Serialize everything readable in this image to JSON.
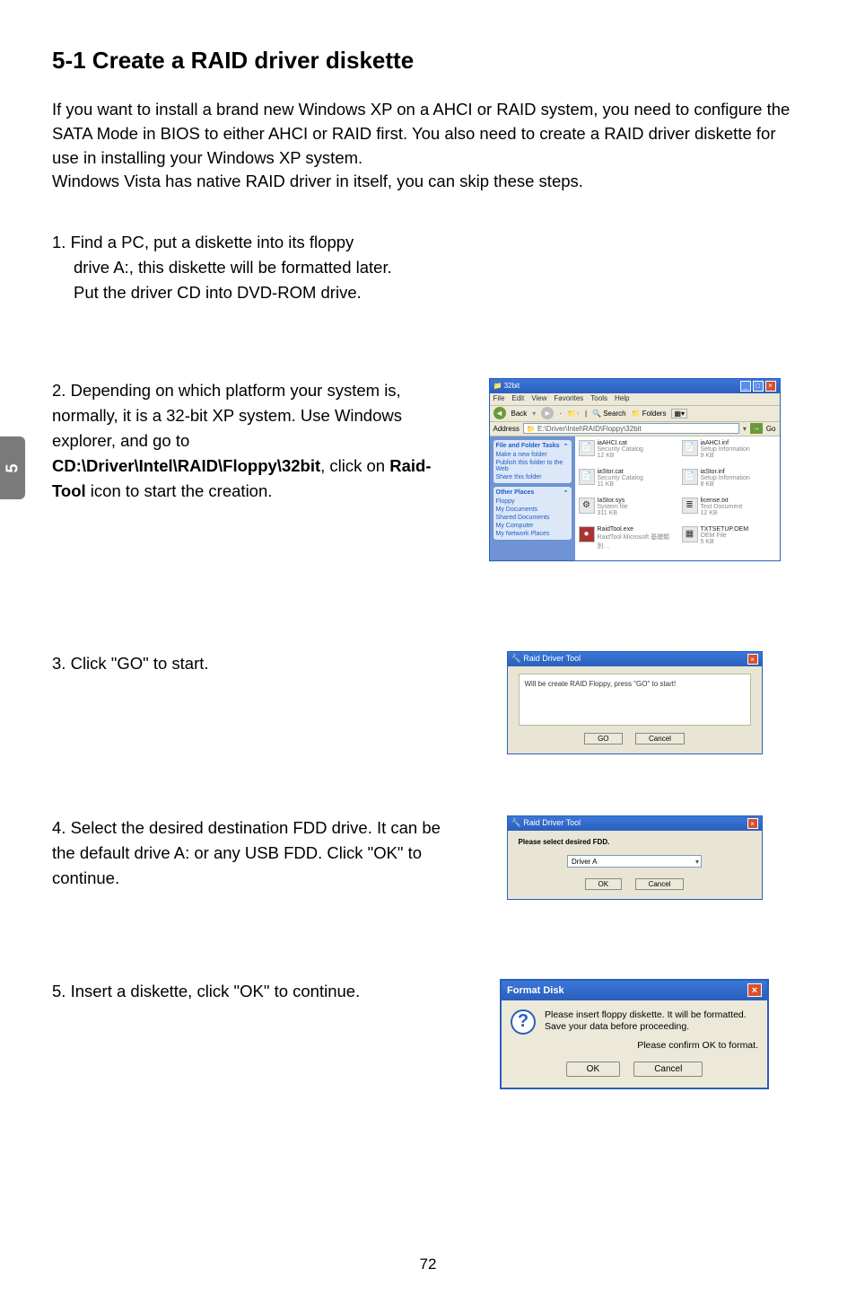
{
  "side_tab": "5",
  "title": "5-1 Create a RAID driver diskette",
  "intro": "If you want to install a brand new Windows XP on a AHCI or RAID system, you need to configure the SATA Mode in BIOS to either AHCI or RAID first. You also need to create a RAID driver diskette for use in installing your Windows XP system.\nWindows Vista has native RAID driver in itself, you can skip these steps.",
  "steps": {
    "s1": {
      "n": "1.",
      "l1": "Find a PC, put a diskette into its floppy",
      "l2": "drive A:, this diskette will be formatted later.",
      "l3": "Put the driver CD into DVD-ROM drive."
    },
    "s2": {
      "n": "2.",
      "t": "Depending on which platform your system is, normally, it is a 32-bit XP system. Use Windows explorer, and go to ",
      "path": "CD:\\Driver\\Intel\\RAID\\Floppy\\32bit",
      "mid": ", click on ",
      "bold2": "Raid-Tool",
      "end": " icon to start the creation."
    },
    "s3": {
      "n": "3.",
      "t": "Click \"GO\" to start."
    },
    "s4": {
      "n": "4.",
      "t": "Select the desired destination FDD drive. It can be the default drive A: or any USB FDD. Click \"OK\" to continue."
    },
    "s5": {
      "n": "5.",
      "t": "Insert a diskette, click \"OK\" to continue."
    }
  },
  "explorer": {
    "title": "32bit",
    "menus": [
      "File",
      "Edit",
      "View",
      "Favorites",
      "Tools",
      "Help"
    ],
    "toolbar": {
      "back": "Back",
      "search": "Search",
      "folders": "Folders"
    },
    "addr_label": "Address",
    "addr_path": "E:\\Driver\\Intel\\RAID\\Floppy\\32bit",
    "go": "Go",
    "panel1": {
      "hd": "File and Folder Tasks",
      "items": [
        "Make a new folder",
        "Publish this folder to the Web",
        "Share this folder"
      ]
    },
    "panel2": {
      "hd": "Other Places",
      "items": [
        "Floppy",
        "My Documents",
        "Shared Documents",
        "My Computer",
        "My Network Places"
      ]
    },
    "files": [
      {
        "name": "iaAHCI.cat",
        "type": "Security Catalog",
        "size": "12 KB"
      },
      {
        "name": "iaAHCI.inf",
        "type": "Setup Information",
        "size": "9 KB"
      },
      {
        "name": "iaStor.cat",
        "type": "Security Catalog",
        "size": "11 KB"
      },
      {
        "name": "iaStor.inf",
        "type": "Setup Information",
        "size": "8 KB"
      },
      {
        "name": "IaStor.sys",
        "type": "System file",
        "size": "311 KB"
      },
      {
        "name": "license.txt",
        "type": "Text Document",
        "size": "12 KB"
      },
      {
        "name": "RaidTool.exe",
        "type": "RaidTool Microsoft 基礎類別…",
        "size": ""
      },
      {
        "name": "TXTSETUP.OEM",
        "type": "OEM File",
        "size": "5 KB"
      }
    ]
  },
  "rdt1": {
    "title": "Raid Driver Tool",
    "msg": "Will be create RAID Floppy, press \"GO\" to start!",
    "go": "GO",
    "cancel": "Cancel"
  },
  "rdt2": {
    "title": "Raid Driver Tool",
    "msg": "Please select desired FDD.",
    "drive": "Driver A",
    "ok": "OK",
    "cancel": "Cancel"
  },
  "fmt": {
    "title": "Format Disk",
    "m1": "Please insert floppy diskette.  It will be formatted.",
    "m2": "Save your data before proceeding.",
    "m3": "Please confirm OK to format.",
    "ok": "OK",
    "cancel": "Cancel"
  },
  "page_num": "72"
}
